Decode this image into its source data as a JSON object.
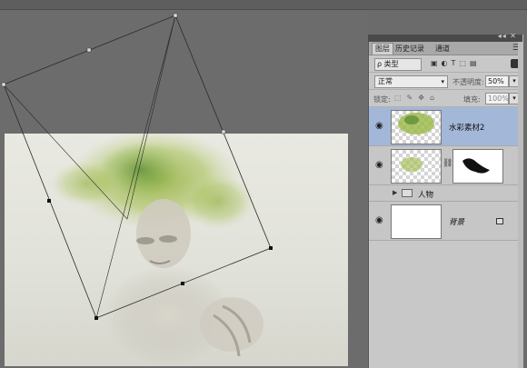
{
  "panel": {
    "tabs": [
      {
        "label": "图层",
        "active": true
      },
      {
        "label": "历史记录",
        "active": false
      },
      {
        "label": "通道",
        "active": false
      }
    ],
    "filter": {
      "label": "ρ 类型"
    },
    "blend": {
      "mode": "正常",
      "opacity_label": "不透明度:",
      "opacity_value": "50%"
    },
    "lock": {
      "label": "锁定:",
      "fill_label": "填充:",
      "fill_value": "100%"
    },
    "layers": [
      {
        "name": "水彩素材2",
        "selected": true,
        "visible": true
      },
      {
        "name": "",
        "visible": true,
        "has_mask": true
      },
      {
        "name": "人物",
        "type": "group",
        "visible": false
      },
      {
        "name": "背景",
        "visible": true,
        "locked": true
      }
    ]
  },
  "colors": {
    "selected_layer": "#a3b8d8",
    "panel_bg": "#c8c8c8",
    "workspace": "#6b6b6b"
  }
}
